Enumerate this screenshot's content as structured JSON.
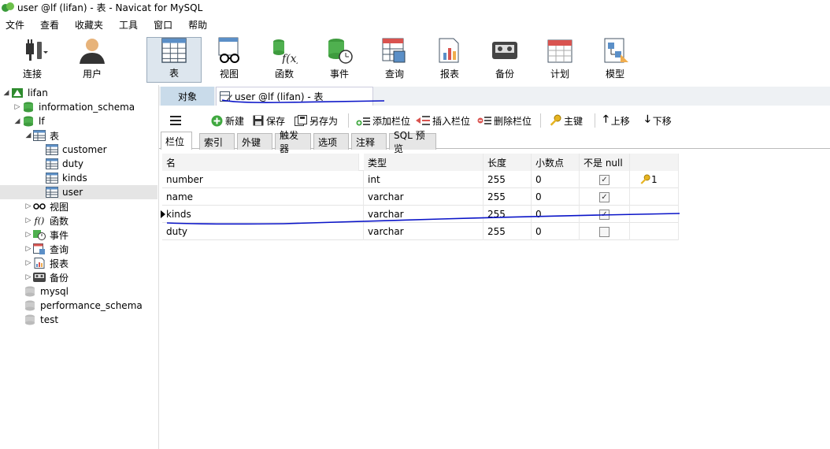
{
  "window": {
    "title": "user @lf (lifan) - 表 - Navicat for MySQL"
  },
  "menu": [
    "文件",
    "查看",
    "收藏夹",
    "工具",
    "窗口",
    "帮助"
  ],
  "toolbar": {
    "connect": "连接",
    "user": "用户",
    "table": "表",
    "view": "视图",
    "function": "函数",
    "event": "事件",
    "query": "查询",
    "report": "报表",
    "backup": "备份",
    "schedule": "计划",
    "model": "模型"
  },
  "tree": {
    "connection": "lifan",
    "information_schema": "information_schema",
    "lf": "lf",
    "tables_folder": "表",
    "tables": [
      "customer",
      "duty",
      "kinds",
      "user"
    ],
    "views": "视图",
    "functions": "函数",
    "events": "事件",
    "queries": "查询",
    "reports": "报表",
    "backups": "备份",
    "mysql": "mysql",
    "performance_schema": "performance_schema",
    "test": "test"
  },
  "tabs": {
    "objects": "对象",
    "user_table": "user @lf (lifan) - 表"
  },
  "actions": {
    "new": "新建",
    "save": "保存",
    "save_as": "另存为",
    "add_field": "添加栏位",
    "insert_field": "插入栏位",
    "delete_field": "删除栏位",
    "primary_key": "主键",
    "move_up": "上移",
    "move_down": "下移"
  },
  "subtabs": [
    "栏位",
    "索引",
    "外键",
    "触发器",
    "选项",
    "注释",
    "SQL 预览"
  ],
  "grid": {
    "headers": [
      "名",
      "类型",
      "长度",
      "小数点",
      "不是 null",
      ""
    ],
    "rows": [
      {
        "name": "number",
        "type": "int",
        "length": "255",
        "decimals": "0",
        "not_null": true,
        "key": "1"
      },
      {
        "name": "name",
        "type": "varchar",
        "length": "255",
        "decimals": "0",
        "not_null": true,
        "key": ""
      },
      {
        "name": "kinds",
        "type": "varchar",
        "length": "255",
        "decimals": "0",
        "not_null": true,
        "key": ""
      },
      {
        "name": "duty",
        "type": "varchar",
        "length": "255",
        "decimals": "0",
        "not_null": false,
        "key": ""
      }
    ]
  },
  "colors": {
    "annotation_ink": "#0a14c8",
    "active_tab": "#c9dbea",
    "selected_row": "#e5e5e5"
  }
}
